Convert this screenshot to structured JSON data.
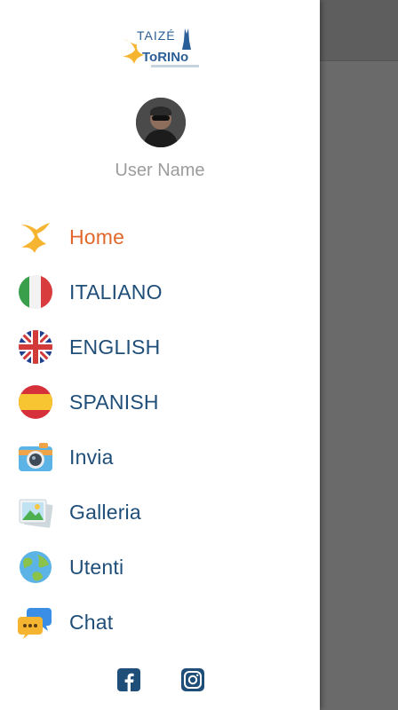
{
  "logo": {
    "text_top": "TAIZÉ",
    "text_main": "ToRINo"
  },
  "profile": {
    "username": "User Name"
  },
  "menu": [
    {
      "label": "Home",
      "icon": "taize-cross-icon",
      "active": true
    },
    {
      "label": "ITALIANO",
      "icon": "italy-flag-icon"
    },
    {
      "label": "ENGLISH",
      "icon": "uk-flag-icon"
    },
    {
      "label": "SPANISH",
      "icon": "spain-flag-icon"
    },
    {
      "label": "Invia",
      "icon": "camera-icon"
    },
    {
      "label": "Galleria",
      "icon": "gallery-icon"
    },
    {
      "label": "Utenti",
      "icon": "globe-icon"
    },
    {
      "label": "Chat",
      "icon": "chat-icon"
    }
  ],
  "social": [
    {
      "icon": "facebook-icon"
    },
    {
      "icon": "instagram-icon"
    }
  ],
  "colors": {
    "accent": "#e2672b",
    "menu_text": "#1f4e79",
    "social": "#1f4e79"
  }
}
